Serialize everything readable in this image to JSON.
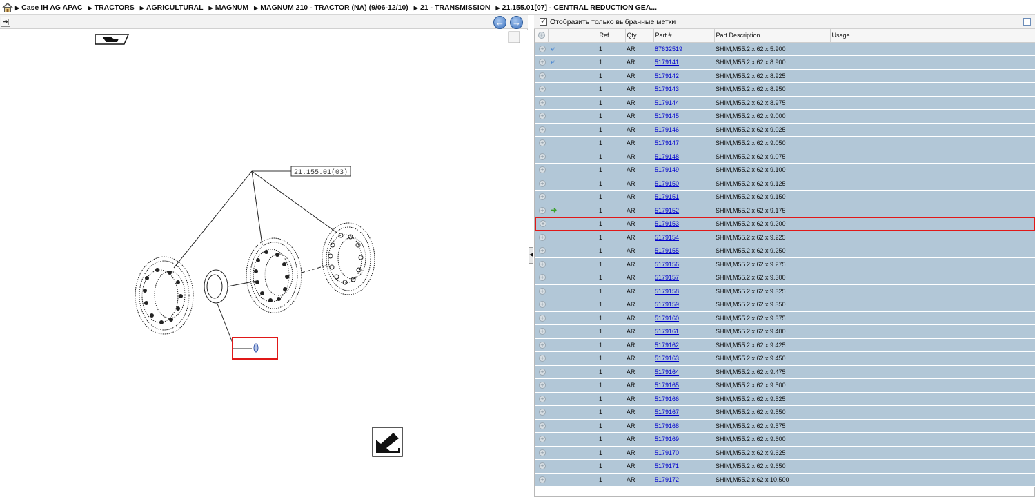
{
  "breadcrumb": {
    "home_icon": "home-icon",
    "items": [
      "Case IH AG APAC",
      "TRACTORS",
      "AGRICULTURAL",
      "MAGNUM",
      "MAGNUM 210 - TRACTOR (NA) (9/06-12/10)",
      "21 - TRANSMISSION",
      "21.155.01[07] - CENTRAL REDUCTION GEA..."
    ]
  },
  "diagram": {
    "callout_label": "21.155.01(03)",
    "back_icon": "arrow-left-icon",
    "forward_icon": "arrow-right-icon"
  },
  "parts": {
    "filter_label": "Отобразить только выбранные метки",
    "filter_checked": true,
    "columns": {
      "ref": "Ref",
      "qty": "Qty",
      "part": "Part #",
      "desc": "Part Description",
      "usage": "Usage"
    },
    "rows": [
      {
        "ref": "1",
        "qty": "AR",
        "part": "87632519",
        "desc": "SHIM,M55.2 x 62 x 5.900",
        "mark": "blue-arrow"
      },
      {
        "ref": "1",
        "qty": "AR",
        "part": "5179141",
        "desc": "SHIM,M55.2 x 62 x 8.900",
        "mark": "blue-arrow"
      },
      {
        "ref": "1",
        "qty": "AR",
        "part": "5179142",
        "desc": "SHIM,M55.2 x 62 x 8.925",
        "mark": ""
      },
      {
        "ref": "1",
        "qty": "AR",
        "part": "5179143",
        "desc": "SHIM,M55.2 x 62 x 8.950",
        "mark": ""
      },
      {
        "ref": "1",
        "qty": "AR",
        "part": "5179144",
        "desc": "SHIM,M55.2 x 62 x 8.975",
        "mark": ""
      },
      {
        "ref": "1",
        "qty": "AR",
        "part": "5179145",
        "desc": "SHIM,M55.2 x 62 x 9.000",
        "mark": ""
      },
      {
        "ref": "1",
        "qty": "AR",
        "part": "5179146",
        "desc": "SHIM,M55.2 x 62 x 9.025",
        "mark": ""
      },
      {
        "ref": "1",
        "qty": "AR",
        "part": "5179147",
        "desc": "SHIM,M55.2 x 62 x 9.050",
        "mark": ""
      },
      {
        "ref": "1",
        "qty": "AR",
        "part": "5179148",
        "desc": "SHIM,M55.2 x 62 x 9.075",
        "mark": ""
      },
      {
        "ref": "1",
        "qty": "AR",
        "part": "5179149",
        "desc": "SHIM,M55.2 x 62 x 9.100",
        "mark": ""
      },
      {
        "ref": "1",
        "qty": "AR",
        "part": "5179150",
        "desc": "SHIM,M55.2 x 62 x 9.125",
        "mark": ""
      },
      {
        "ref": "1",
        "qty": "AR",
        "part": "5179151",
        "desc": "SHIM,M55.2 x 62 x 9.150",
        "mark": ""
      },
      {
        "ref": "1",
        "qty": "AR",
        "part": "5179152",
        "desc": "SHIM,M55.2 x 62 x 9.175",
        "mark": "green-arrow"
      },
      {
        "ref": "1",
        "qty": "AR",
        "part": "5179153",
        "desc": "SHIM,M55.2 x 62 x 9.200",
        "mark": "",
        "selected": true
      },
      {
        "ref": "1",
        "qty": "AR",
        "part": "5179154",
        "desc": "SHIM,M55.2 x 62 x 9.225",
        "mark": ""
      },
      {
        "ref": "1",
        "qty": "AR",
        "part": "5179155",
        "desc": "SHIM,M55.2 x 62 x 9.250",
        "mark": ""
      },
      {
        "ref": "1",
        "qty": "AR",
        "part": "5179156",
        "desc": "SHIM,M55.2 x 62 x 9.275",
        "mark": ""
      },
      {
        "ref": "1",
        "qty": "AR",
        "part": "5179157",
        "desc": "SHIM,M55.2 x 62 x 9.300",
        "mark": ""
      },
      {
        "ref": "1",
        "qty": "AR",
        "part": "5179158",
        "desc": "SHIM,M55.2 x 62 x 9.325",
        "mark": ""
      },
      {
        "ref": "1",
        "qty": "AR",
        "part": "5179159",
        "desc": "SHIM,M55.2 x 62 x 9.350",
        "mark": ""
      },
      {
        "ref": "1",
        "qty": "AR",
        "part": "5179160",
        "desc": "SHIM,M55.2 x 62 x 9.375",
        "mark": ""
      },
      {
        "ref": "1",
        "qty": "AR",
        "part": "5179161",
        "desc": "SHIM,M55.2 x 62 x 9.400",
        "mark": ""
      },
      {
        "ref": "1",
        "qty": "AR",
        "part": "5179162",
        "desc": "SHIM,M55.2 x 62 x 9.425",
        "mark": ""
      },
      {
        "ref": "1",
        "qty": "AR",
        "part": "5179163",
        "desc": "SHIM,M55.2 x 62 x 9.450",
        "mark": ""
      },
      {
        "ref": "1",
        "qty": "AR",
        "part": "5179164",
        "desc": "SHIM,M55.2 x 62 x 9.475",
        "mark": ""
      },
      {
        "ref": "1",
        "qty": "AR",
        "part": "5179165",
        "desc": "SHIM,M55.2 x 62 x 9.500",
        "mark": ""
      },
      {
        "ref": "1",
        "qty": "AR",
        "part": "5179166",
        "desc": "SHIM,M55.2 x 62 x 9.525",
        "mark": ""
      },
      {
        "ref": "1",
        "qty": "AR",
        "part": "5179167",
        "desc": "SHIM,M55.2 x 62 x 9.550",
        "mark": ""
      },
      {
        "ref": "1",
        "qty": "AR",
        "part": "5179168",
        "desc": "SHIM,M55.2 x 62 x 9.575",
        "mark": ""
      },
      {
        "ref": "1",
        "qty": "AR",
        "part": "5179169",
        "desc": "SHIM,M55.2 x 62 x 9.600",
        "mark": ""
      },
      {
        "ref": "1",
        "qty": "AR",
        "part": "5179170",
        "desc": "SHIM,M55.2 x 62 x 9.625",
        "mark": ""
      },
      {
        "ref": "1",
        "qty": "AR",
        "part": "5179171",
        "desc": "SHIM,M55.2 x 62 x 9.650",
        "mark": ""
      },
      {
        "ref": "1",
        "qty": "AR",
        "part": "5179172",
        "desc": "SHIM,M55.2 x 62 x 10.500",
        "mark": ""
      }
    ]
  }
}
